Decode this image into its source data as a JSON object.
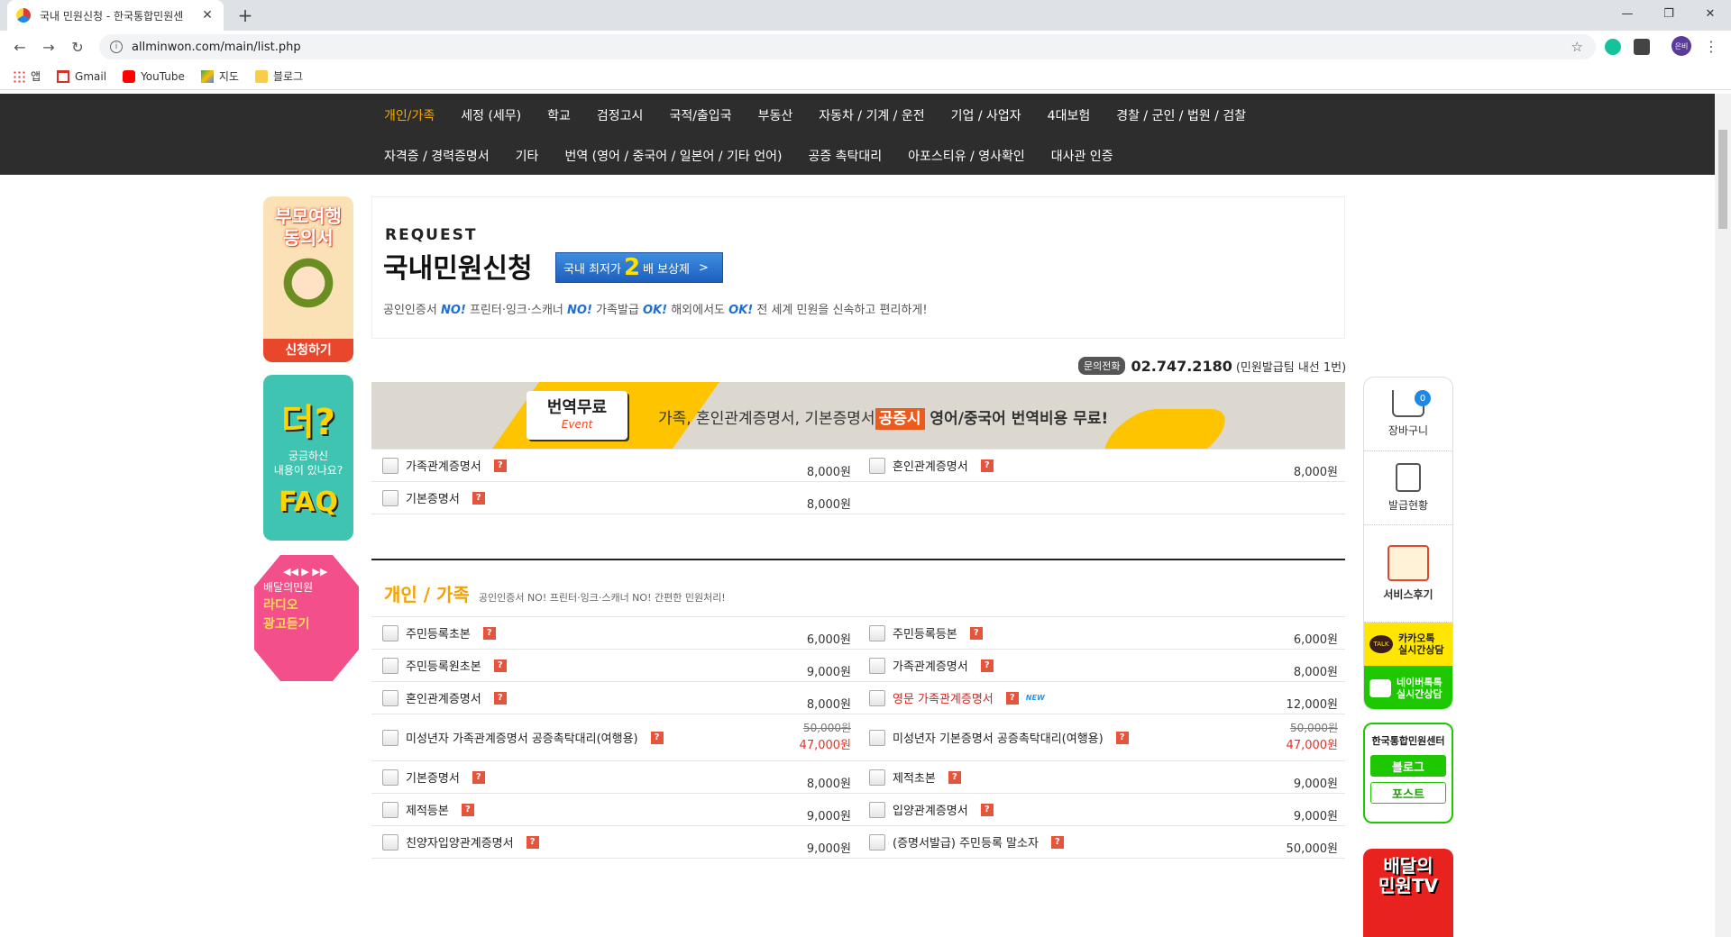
{
  "browser": {
    "tab_title": "국내 민원신청 - 한국통합민원센",
    "url": "allminwon.com/main/list.php",
    "avatar_label": "은비",
    "bookmarks": [
      "앱",
      "Gmail",
      "YouTube",
      "지도",
      "블로그"
    ]
  },
  "nav": {
    "row1": [
      "개인/가족",
      "세정 (세무)",
      "학교",
      "검정고시",
      "국적/출입국",
      "부동산",
      "자동차 / 기계 / 운전",
      "기업 / 사업자",
      "4대보험",
      "경찰 / 군인 / 법원 / 검찰"
    ],
    "row2": [
      "자격증 / 경력증명서",
      "기타",
      "번역 (영어 / 중국어 / 일본어 / 기타 언어)",
      "공증 촉탁대리",
      "아포스티유 / 영사확인",
      "대사관 인증"
    ]
  },
  "side_banners": {
    "b1_title_1": "부모여행",
    "b1_title_2": "동의서",
    "b1_apply": "신청하기",
    "b2_top": "더",
    "b2_text_1": "궁금하신",
    "b2_text_2": "내용이 있나요?",
    "b2_faq": "FAQ",
    "b3_controls": "◀◀ ▶ ▶▶",
    "b3_text_1": "배달의민원",
    "b3_text_2": "라디오",
    "b3_text_3": "광고듣기"
  },
  "request": {
    "eng": "REQUEST",
    "kor": "국내민원신청",
    "reward_pre": "국내 최저가",
    "reward_num": "2",
    "reward_post": "배 보상제",
    "reward_arrow": ">",
    "desc_1": "공인인증서 ",
    "desc_no1": "NO!",
    "desc_2": " 프린터·잉크·스캐너 ",
    "desc_no2": "NO!",
    "desc_3": " 가족발급 ",
    "desc_ok1": "OK!",
    "desc_4": " 해외에서도 ",
    "desc_ok2": "OK!",
    "desc_5": " 전 세계 민원을 신속하고 편리하게!"
  },
  "phone": {
    "label": "문의전화",
    "number": "02.747.2180",
    "sub": "(민원발급팀 내선 1번)"
  },
  "event": {
    "badge_1": "번역무료",
    "badge_2": "Event",
    "text_1": "가족, 혼인관계증명서, 기본증명서",
    "highlight": "공증시",
    "text_2": " 영어/중국어 번역비용 무료!"
  },
  "event_docs": [
    [
      {
        "name": "가족관계증명서",
        "price": "8,000원"
      },
      {
        "name": "혼인관계증명서",
        "price": "8,000원"
      }
    ],
    [
      {
        "name": "기본증명서",
        "price": "8,000원"
      },
      null
    ]
  ],
  "section": {
    "title": "개인 / 가족",
    "subtitle": "공인인증서 NO! 프린터·잉크·스캐너 NO! 간편한 민원처리!"
  },
  "section_docs": [
    [
      {
        "name": "주민등록초본",
        "price": "6,000원"
      },
      {
        "name": "주민등록등본",
        "price": "6,000원"
      }
    ],
    [
      {
        "name": "주민등록원초본",
        "price": "9,000원"
      },
      {
        "name": "가족관계증명서",
        "price": "8,000원"
      }
    ],
    [
      {
        "name": "혼인관계증명서",
        "price": "8,000원"
      },
      {
        "name": "영문 가족관계증명서",
        "price": "12,000원",
        "red": true,
        "new": "NEW"
      }
    ],
    [
      {
        "name": "미성년자 가족관계증명서 공증촉탁대리(여행용)",
        "old": "50,000원",
        "sale": "47,000원"
      },
      {
        "name": "미성년자 기본증명서 공증촉탁대리(여행용)",
        "old": "50,000원",
        "sale": "47,000원"
      }
    ],
    [
      {
        "name": "기본증명서",
        "price": "8,000원"
      },
      {
        "name": "제적초본",
        "price": "9,000원"
      }
    ],
    [
      {
        "name": "제적등본",
        "price": "9,000원"
      },
      {
        "name": "입양관계증명서",
        "price": "9,000원"
      }
    ],
    [
      {
        "name": "친양자입양관계증명서",
        "price": "9,000원"
      },
      {
        "name": "(증명서발급) 주민등록 말소자",
        "price": "50,000원"
      }
    ]
  ],
  "quick": {
    "cart": "장바구니",
    "cart_count": "0",
    "status": "발급현황",
    "review": "서비스후기",
    "kakao_icon": "TALK",
    "kakao_1": "카카오톡",
    "kakao_2": "실시간상담",
    "naver_1": "네이버톡톡",
    "naver_2": "실시간상담"
  },
  "center": {
    "title": "한국통합민원센터",
    "blog": "블로그",
    "post": "포스트"
  },
  "tv": {
    "t1": "배달의",
    "t2": "민원TV"
  }
}
